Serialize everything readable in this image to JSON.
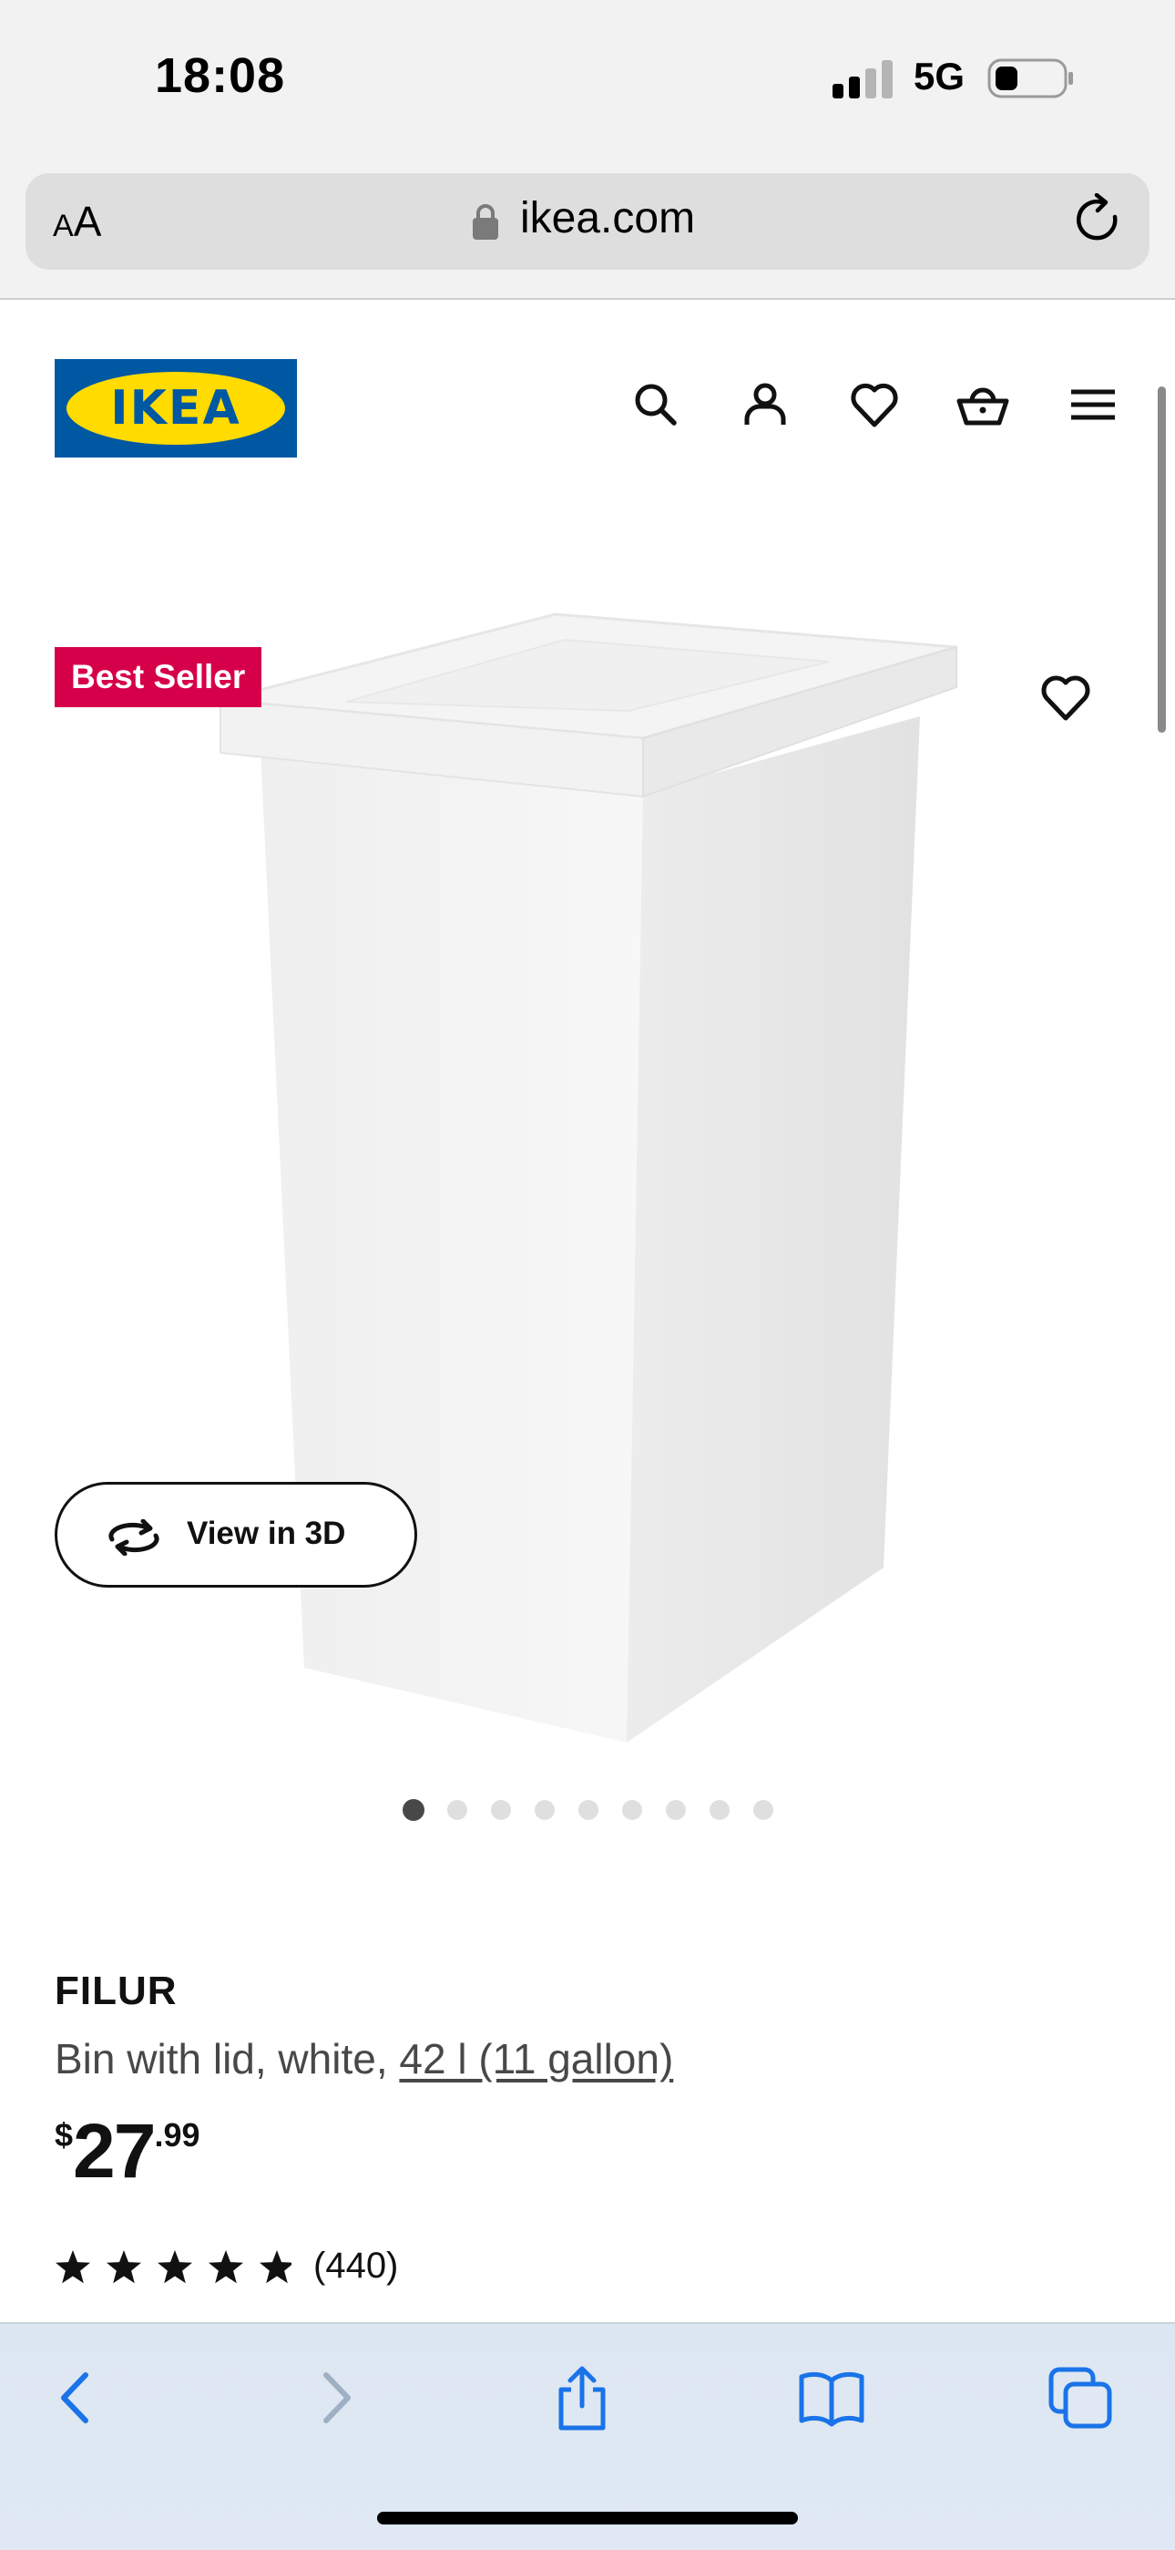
{
  "status_bar": {
    "time": "18:08",
    "network": "5G"
  },
  "browser": {
    "text_size_button": {
      "small": "A",
      "large": "A"
    },
    "url": "ikea.com"
  },
  "header": {
    "logo_text": "IKEA"
  },
  "product": {
    "badge": "Best Seller",
    "view_3d_label": "View in 3D",
    "image_count": 9,
    "active_image_index": 0,
    "name": "FILUR",
    "description_prefix": "Bin with lid, white, ",
    "description_size": "42 l (11 gallon)",
    "price": {
      "currency": "$",
      "integer": "27",
      "decimal": ".99"
    },
    "rating": 5,
    "review_count": "(440)"
  },
  "colors": {
    "ikea_blue": "#0058a3",
    "ikea_yellow": "#ffdb00",
    "badge_pink": "#d6004a",
    "safari_blue": "#1a73e8"
  }
}
